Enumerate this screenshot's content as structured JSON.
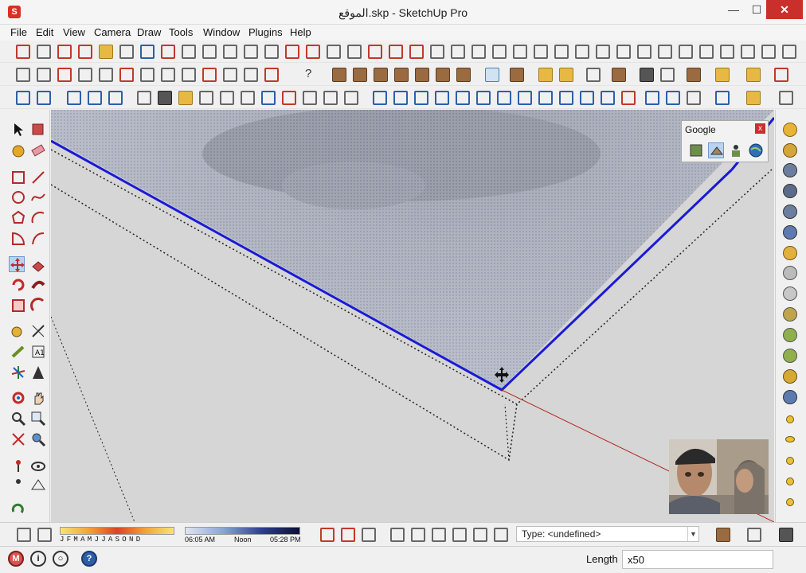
{
  "window": {
    "title": "الموقع.skp - SketchUp Pro",
    "minimize_glyph": "—",
    "maximize_glyph": "☐",
    "close_glyph": "✕"
  },
  "menu": [
    "File",
    "Edit",
    "View",
    "Camera",
    "Draw",
    "Tools",
    "Window",
    "Plugins",
    "Help"
  ],
  "google_panel": {
    "title": "Google",
    "close_glyph": "x"
  },
  "shadows": {
    "months_label": "JFMAMJJASOND",
    "time_start": "06:05 AM",
    "time_noon": "Noon",
    "time_end": "05:28 PM"
  },
  "type_field": {
    "value": "Type: <undefined>"
  },
  "status": {
    "length_label": "Length",
    "length_value": "x50"
  },
  "colors": {
    "accent": "#2d5fa8",
    "close_red": "#c9302c",
    "selected_edge": "#1a1ad6",
    "axis_red": "#b3261e"
  }
}
